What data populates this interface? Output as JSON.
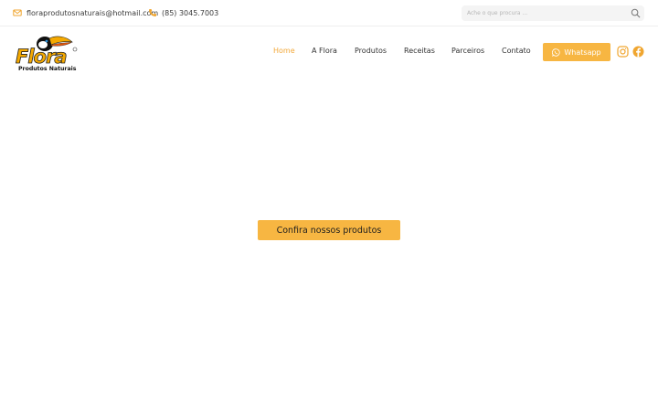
{
  "topbar": {
    "email": "floraprodutosnaturais@hotmail.com",
    "phone": "(85) 3045.7003",
    "search_placeholder": "Ache o que procura ..."
  },
  "logo": {
    "wordmark": "Flora",
    "tagline": "Produtos Naturais"
  },
  "nav": {
    "items": [
      {
        "label": "Home",
        "active": true
      },
      {
        "label": "A Flora",
        "active": false
      },
      {
        "label": "Produtos",
        "active": false
      },
      {
        "label": "Receitas",
        "active": false
      },
      {
        "label": "Parceiros",
        "active": false
      },
      {
        "label": "Contato",
        "active": false
      }
    ],
    "whatsapp_label": "Whatsapp"
  },
  "social": [
    "instagram-icon",
    "facebook-icon"
  ],
  "hero": {
    "cta_label": "Confira nossos produtos"
  },
  "colors": {
    "accent": "#f7b642",
    "nav_active": "#f2a93b",
    "icon_orange": "#f0a630"
  }
}
